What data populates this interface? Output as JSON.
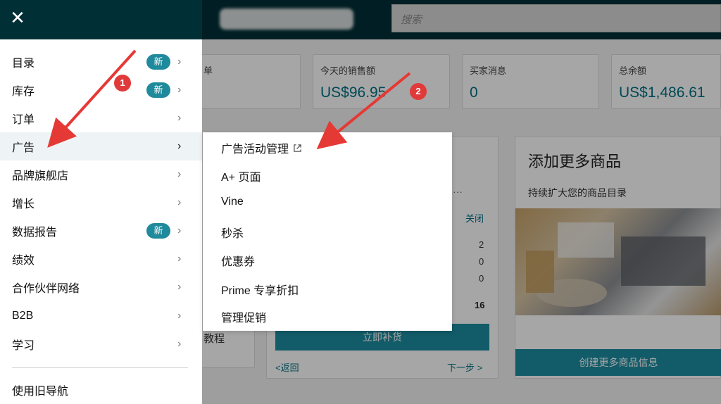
{
  "topbar": {
    "search_placeholder": "搜索"
  },
  "cards": [
    {
      "label": "单",
      "value": ""
    },
    {
      "label": "今天的销售额",
      "value": "US$96.95"
    },
    {
      "label": "买家消息",
      "value": "0"
    },
    {
      "label": "总余额",
      "value": "US$1,486.61"
    }
  ],
  "panel_left": {
    "text": "教程"
  },
  "panel_mid": {
    "close": "关闭",
    "dots": "···",
    "nums": [
      "2",
      "0",
      "0",
      "16"
    ],
    "button": "立即补货",
    "back": "<返回",
    "next": "下一步 >"
  },
  "panel_right": {
    "title": "添加更多商品",
    "subtitle": "持续扩大您的商品目录",
    "button": "创建更多商品信息"
  },
  "menu": {
    "items": [
      {
        "label": "目录",
        "badge": "新"
      },
      {
        "label": "库存",
        "badge": "新"
      },
      {
        "label": "订单",
        "badge": ""
      },
      {
        "label": "广告",
        "badge": ""
      },
      {
        "label": "品牌旗舰店",
        "badge": ""
      },
      {
        "label": "增长",
        "badge": ""
      },
      {
        "label": "数据报告",
        "badge": "新"
      },
      {
        "label": "绩效",
        "badge": ""
      },
      {
        "label": "合作伙伴网络",
        "badge": ""
      },
      {
        "label": "B2B",
        "badge": ""
      },
      {
        "label": "学习",
        "badge": ""
      }
    ],
    "footer": "使用旧导航"
  },
  "submenu": {
    "items": [
      "广告活动管理",
      "A+ 页面",
      "Vine",
      "秒杀",
      "优惠券",
      "Prime 专享折扣",
      "管理促销"
    ]
  },
  "annotations": {
    "n1": "1",
    "n2": "2",
    "arrow_color": "#e53935"
  },
  "colors": {
    "topbar": "#002f36",
    "badge": "#1f8a9c",
    "link": "#007185"
  }
}
